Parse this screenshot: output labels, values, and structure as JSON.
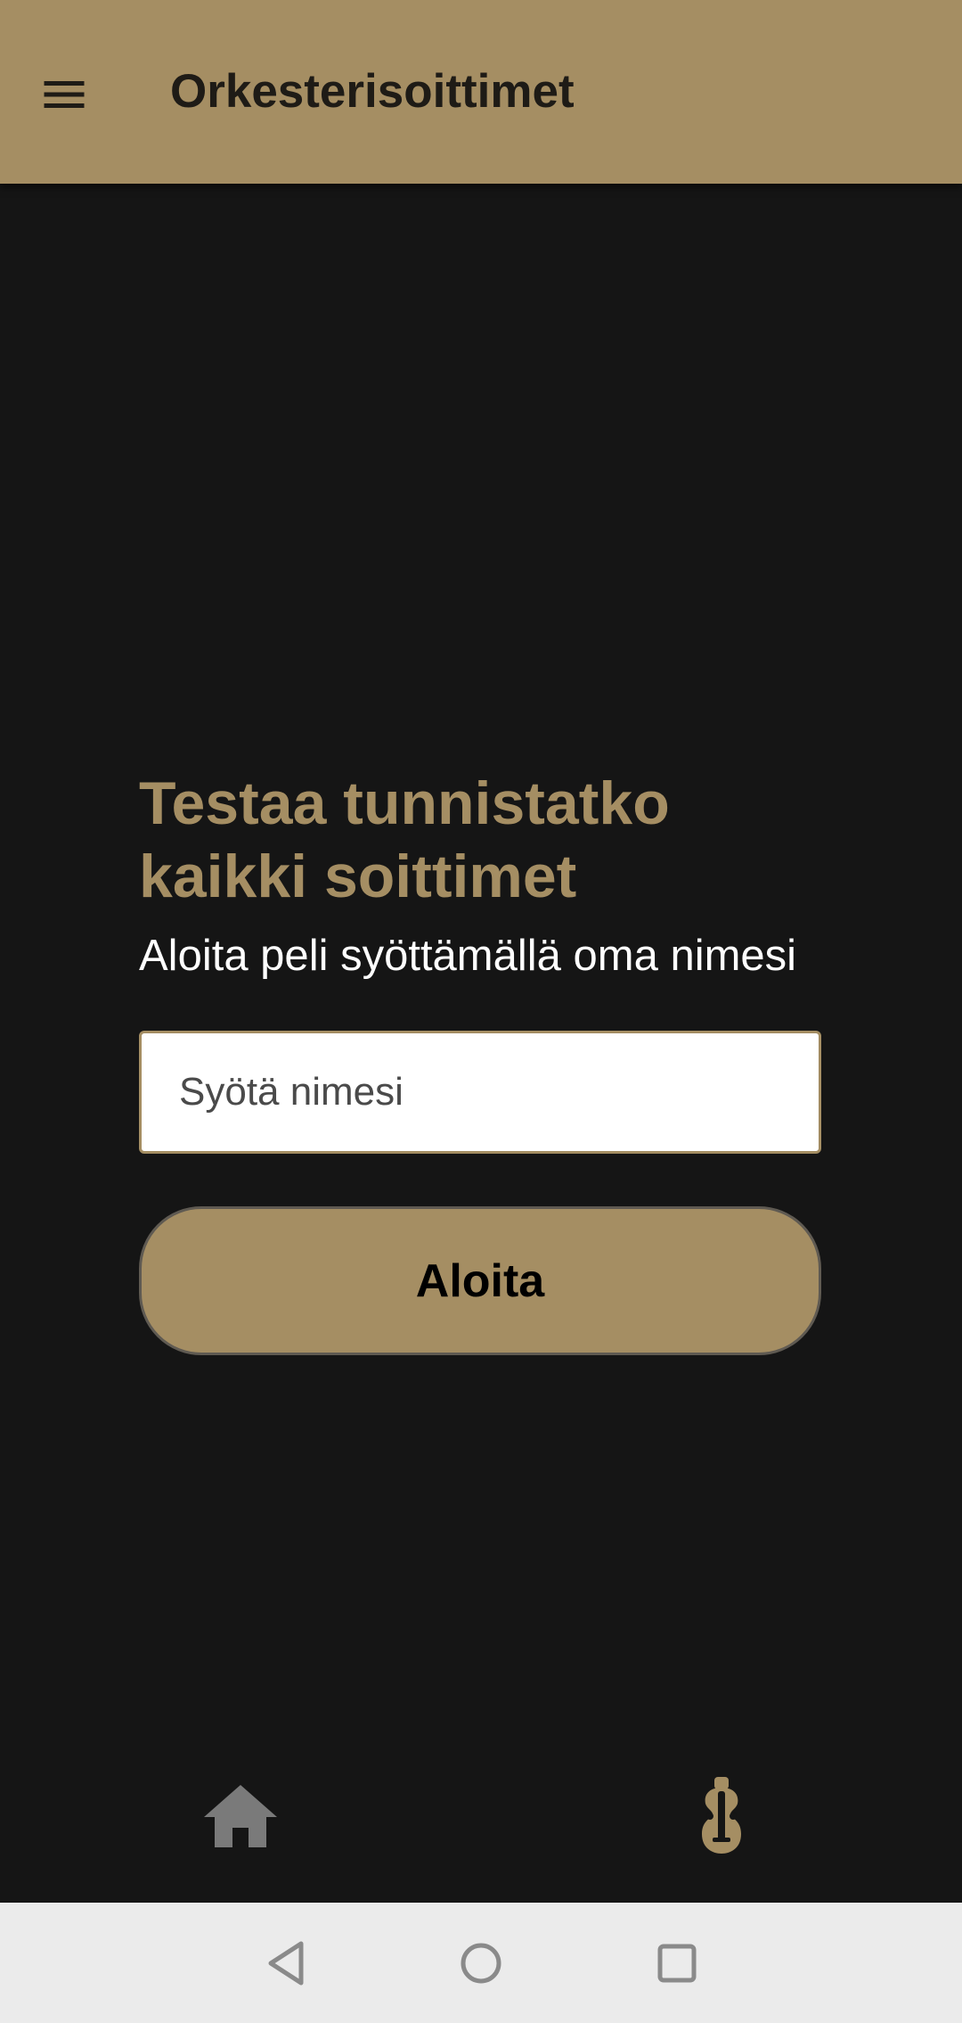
{
  "app_bar": {
    "title": "Orkesterisoittimet",
    "menu_icon": "hamburger-menu-icon",
    "background_color": "#a58e63"
  },
  "main": {
    "headline_line1": "Testaa tunnistatko",
    "headline_line2": "kaikki soittimet",
    "subtext": "Aloita peli syöttämällä oma nimesi",
    "name_input": {
      "value": "",
      "placeholder": "Syötä nimesi"
    },
    "start_button_label": "Aloita"
  },
  "bottom_nav": {
    "items": [
      {
        "icon": "home-icon",
        "color": "#7a7a7a",
        "active": false
      },
      {
        "icon": "violin-icon",
        "color": "#a58e63",
        "active": true
      }
    ]
  },
  "system_nav": {
    "back_icon": "back-triangle-icon",
    "home_icon": "home-circle-icon",
    "recents_icon": "recents-square-icon"
  },
  "colors": {
    "accent": "#a58e63",
    "background": "#151515",
    "text_light": "#ffffff"
  }
}
